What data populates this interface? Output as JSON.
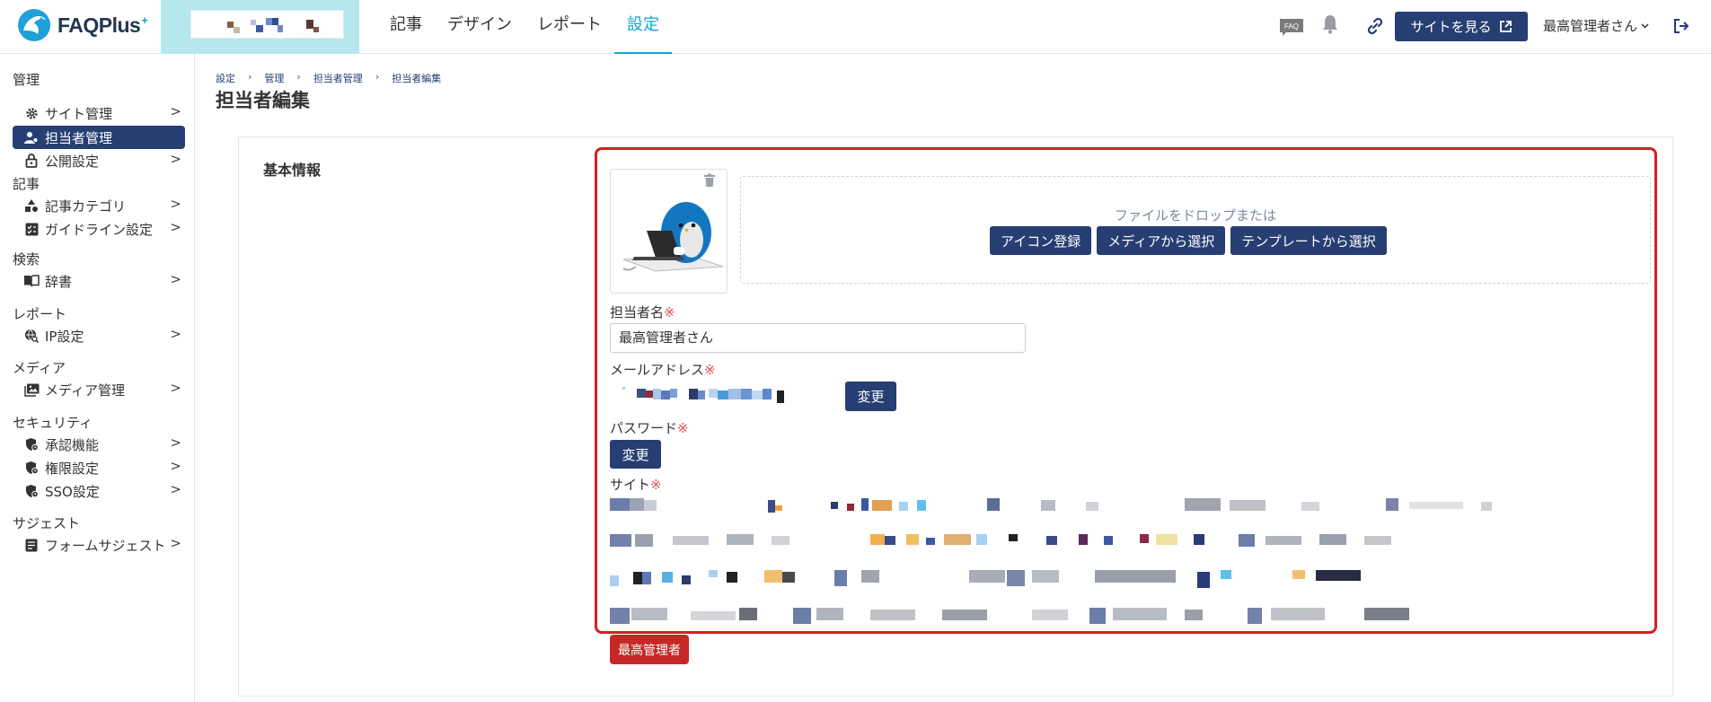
{
  "header": {
    "logo_text": "FAQPlus",
    "logo_sup": "+",
    "nav": [
      {
        "label": "記事",
        "active": false
      },
      {
        "label": "デザイン",
        "active": false
      },
      {
        "label": "レポート",
        "active": false
      },
      {
        "label": "設定",
        "active": true
      }
    ],
    "faq_icon_text": "FAQ",
    "view_site_label": "サイトを見る",
    "user_label": "最高管理者さん"
  },
  "sidebar": {
    "groups": [
      {
        "label": "管理",
        "items": [
          {
            "label": "サイト管理",
            "icon": "gear-icon",
            "active": false
          },
          {
            "label": "担当者管理",
            "icon": "users-icon",
            "active": true
          },
          {
            "label": "公開設定",
            "icon": "lock-icon",
            "active": false
          }
        ]
      },
      {
        "label": "記事",
        "items": [
          {
            "label": "記事カテゴリ",
            "icon": "shapes-icon",
            "active": false
          },
          {
            "label": "ガイドライン設定",
            "icon": "checklist-icon",
            "active": false
          }
        ]
      },
      {
        "label": "検索",
        "items": [
          {
            "label": "辞書",
            "icon": "book-icon",
            "active": false
          }
        ]
      },
      {
        "label": "レポート",
        "items": [
          {
            "label": "IP設定",
            "icon": "globe-search-icon",
            "active": false
          }
        ]
      },
      {
        "label": "メディア",
        "items": [
          {
            "label": "メディア管理",
            "icon": "images-icon",
            "active": false
          }
        ]
      },
      {
        "label": "セキュリティ",
        "items": [
          {
            "label": "承認機能",
            "icon": "shield-icon",
            "active": false
          },
          {
            "label": "権限設定",
            "icon": "shield-icon",
            "active": false
          },
          {
            "label": "SSO設定",
            "icon": "shield-icon",
            "active": false
          }
        ]
      },
      {
        "label": "サジェスト",
        "items": [
          {
            "label": "フォームサジェスト",
            "icon": "form-icon",
            "active": false
          }
        ]
      }
    ]
  },
  "breadcrumb": [
    "設定",
    "管理",
    "担当者管理",
    "担当者編集"
  ],
  "page_title": "担当者編集",
  "form": {
    "section_label": "基本情報",
    "drop_text": "ファイルをドロップまたは",
    "upload_buttons": [
      "アイコン登録",
      "メディアから選択",
      "テンプレートから選択"
    ],
    "name_label": "担当者名",
    "name_value": "最高管理者さん",
    "email_label": "メールアドレス",
    "email_change_label": "変更",
    "password_label": "パスワード",
    "password_change_label": "変更",
    "site_label": "サイト",
    "required_mark": "※",
    "role_badge": "最高管理者"
  },
  "colors": {
    "primary": "#263e72",
    "accent": "#12a4d6",
    "danger": "#c62828",
    "highlight": "#d42020",
    "site_selector_bg": "#b6e7ee"
  }
}
